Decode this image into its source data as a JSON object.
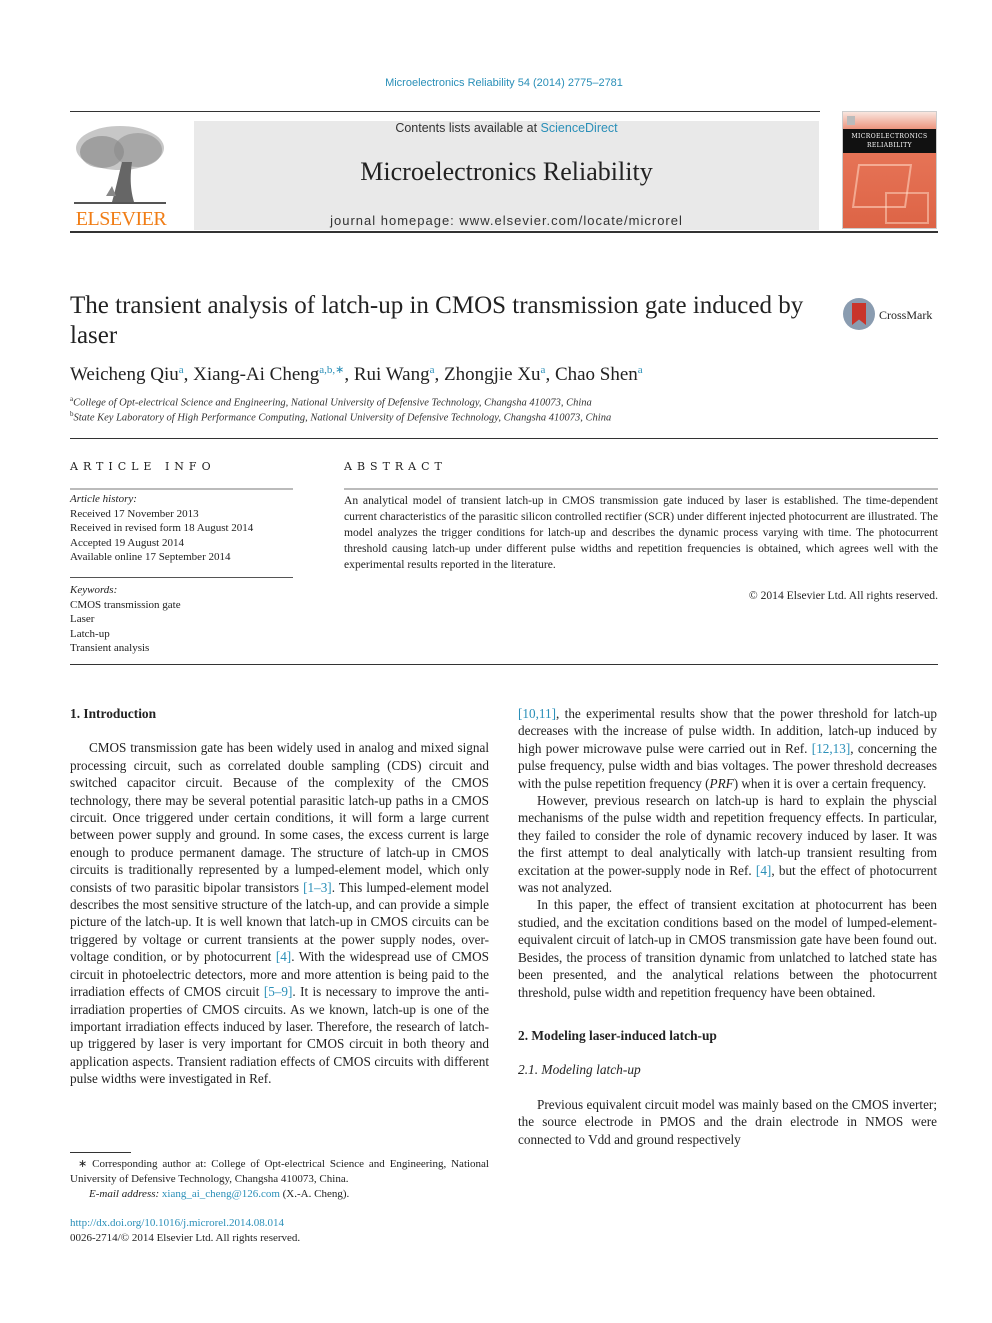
{
  "header": {
    "journal_ref": "Microelectronics Reliability 54 (2014) 2775–2781",
    "contents_prefix": "Contents lists available at ",
    "contents_link": "ScienceDirect",
    "journal_title": "Microelectronics Reliability",
    "homepage_prefix": "journal homepage: ",
    "homepage_url": "www.elsevier.com/locate/microrel",
    "publisher_logo_text": "ELSEVIER",
    "cover_title_line1": "MICROELECTRONICS",
    "cover_title_line2": "RELIABILITY",
    "crossmark_label": "CrossMark",
    "colors": {
      "link": "#2a8fb8",
      "elsevier_orange": "#f07d16",
      "cover_orange": "#dd6446",
      "banner_grey": "#e9e9e9"
    }
  },
  "article": {
    "title": "The transient analysis of latch-up in CMOS transmission gate induced by laser",
    "authors": [
      {
        "name": "Weicheng Qiu",
        "sup": "a"
      },
      {
        "name": "Xiang-Ai Cheng",
        "sup": "a,b,∗"
      },
      {
        "name": "Rui Wang",
        "sup": "a"
      },
      {
        "name": "Zhongjie Xu",
        "sup": "a"
      },
      {
        "name": "Chao Shen",
        "sup": "a"
      }
    ],
    "affiliations": [
      {
        "mark": "a",
        "text": "College of Opt-electrical Science and Engineering, National University of Defensive Technology, Changsha 410073, China"
      },
      {
        "mark": "b",
        "text": "State Key Laboratory of High Performance Computing, National University of Defensive Technology, Changsha 410073, China"
      }
    ]
  },
  "article_info": {
    "heading": "ARTICLE INFO",
    "history_label": "Article history:",
    "history": [
      "Received 17 November 2013",
      "Received in revised form 18 August 2014",
      "Accepted 19 August 2014",
      "Available online 17 September 2014"
    ],
    "keywords_label": "Keywords:",
    "keywords": [
      "CMOS transmission gate",
      "Laser",
      "Latch-up",
      "Transient analysis"
    ]
  },
  "abstract": {
    "heading": "ABSTRACT",
    "text": "An analytical model of transient latch-up in CMOS transmission gate induced by laser is established. The time-dependent current characteristics of the parasitic silicon controlled rectifier (SCR) under different injected photocurrent are illustrated. The model analyzes the trigger conditions for latch-up and describes the dynamic process varying with time. The photocurrent threshold causing latch-up under different pulse widths and repetition frequencies is obtained, which agrees well with the experimental results reported in the literature.",
    "copyright": "© 2014 Elsevier Ltd. All rights reserved."
  },
  "body": {
    "sec1_heading": "1. Introduction",
    "p1_a": "CMOS transmission gate has been widely used in analog and mixed signal processing circuit, such as correlated double sampling (CDS) circuit and switched capacitor circuit. Because of the complexity of the CMOS technology, there may be several potential parasitic latch-up paths in a CMOS circuit. Once triggered under certain conditions, it will form a large current between power supply and ground. In some cases, the excess current is large enough to produce permanent damage. The structure of latch-up in CMOS circuits is traditionally represented by a lumped-element model, which only consists of two parasitic bipolar transistors ",
    "ref_1_3": "[1–3]",
    "p1_b": ". This lumped-element model describes the most sensitive structure of the latch-up, and can provide a simple picture of the latch-up. It is well known that latch-up in CMOS circuits can be triggered by voltage or current transients at the power supply nodes, over-voltage condition, or by photocurrent ",
    "ref_4": "[4]",
    "p1_c": ". With the widespread use of CMOS circuit in photoelectric detectors, more and more attention is being paid to the irradiation effects of CMOS circuit ",
    "ref_5_9": "[5–9]",
    "p1_d": ". It is necessary to improve the anti-irradiation properties of CMOS circuits. As we known, latch-up is one of the important irradiation effects induced by laser. Therefore, the research of latch-up triggered by laser is very important for CMOS circuit in both theory and application aspects. Transient radiation effects of CMOS circuits with different pulse widths were investigated in Ref. ",
    "ref_10_11": "[10,11]",
    "p1_e": ", the experimental results show that the power threshold for latch-up decreases with the increase of pulse width. In addition, latch-up induced by high power microwave pulse were carried out in Ref. ",
    "ref_12_13": "[12,13]",
    "p1_f": ", concerning the pulse frequency, pulse width and bias voltages. The power threshold decreases with the pulse repetition frequency (",
    "prf": "PRF",
    "p1_g": ") when it is over a certain frequency.",
    "p2_a": "However, previous research on latch-up is hard to explain the physcial mechanisms of the pulse width and repetition frequency effects. In particular, they failed to consider the role of dynamic recovery induced by laser. It was the first attempt to deal analytically with latch-up transient resulting from excitation at the power-supply node in Ref. ",
    "p2_ref": "[4]",
    "p2_b": ", but the effect of photocurrent was not analyzed.",
    "p3": "In this paper, the effect of transient excitation at photocurrent has been studied, and the excitation conditions based on the model of lumped-element-equivalent circuit of latch-up in CMOS transmission gate have been found out. Besides, the process of transition dynamic from unlatched to latched state has been presented, and the analytical relations between the photocurrent threshold, pulse width and repetition frequency have been obtained.",
    "sec2_heading": "2. Modeling laser-induced latch-up",
    "sec21_heading": "2.1. Modeling latch-up",
    "p4": "Previous equivalent circuit model was mainly based on the CMOS inverter; the source electrode in PMOS and the drain electrode in NMOS were connected to Vdd and ground respectively"
  },
  "footnote": {
    "corresponding": "∗ Corresponding author at: College of Opt-electrical Science and Engineering, National University of Defensive Technology, Changsha 410073, China.",
    "email_label": "E-mail address: ",
    "email": "xiang_ai_cheng@126.com",
    "email_suffix": " (X.-A. Cheng).",
    "doi": "http://dx.doi.org/10.1016/j.microrel.2014.08.014",
    "issn_copyright": "0026-2714/© 2014 Elsevier Ltd. All rights reserved."
  }
}
